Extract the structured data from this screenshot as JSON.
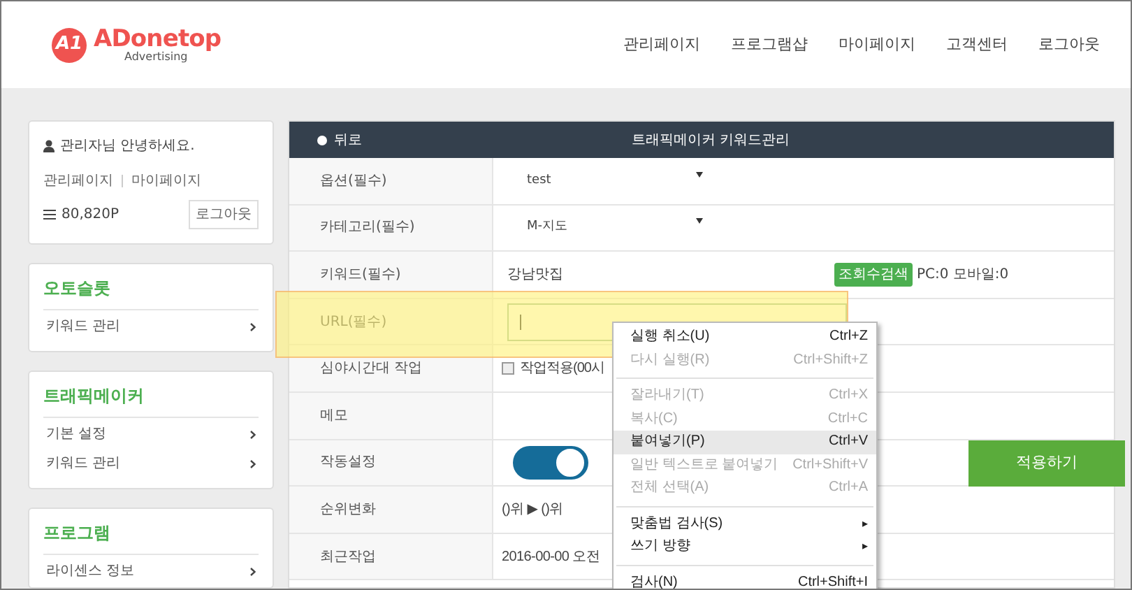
{
  "logo": {
    "mark": "A1",
    "name": "ADonetop",
    "tagline": "Advertising"
  },
  "nav": [
    "관리페이지",
    "프로그램샵",
    "마이페이지",
    "고객센터",
    "로그아웃"
  ],
  "user_card": {
    "greeting": "관리자님 안녕하세요.",
    "links": [
      "관리페이지",
      "마이페이지"
    ],
    "points": "80,820P",
    "logout": "로그아웃"
  },
  "side_menus": [
    {
      "title": "오토슬롯",
      "items": [
        "키워드 관리"
      ]
    },
    {
      "title": "트래픽메이커",
      "items": [
        "기본 설정",
        "키워드 관리"
      ]
    },
    {
      "title": "프로그램",
      "items": [
        "라이센스 정보"
      ]
    }
  ],
  "panel": {
    "back": "뒤로",
    "title": "트래픽메이커 키워드관리"
  },
  "rows": [
    {
      "kind": "select",
      "label": "옵션(필수)",
      "value": "test"
    },
    {
      "kind": "select",
      "label": "카테고리(필수)",
      "value": "M-지도"
    },
    {
      "kind": "keyword",
      "label": "키워드(필수)",
      "value": "강남맛집",
      "button": "조회수검색",
      "result": "PC:0 모바일:0"
    },
    {
      "kind": "input",
      "label": "URL(필수)",
      "focused": true
    },
    {
      "kind": "checkbox",
      "label": "심야시간대 작업",
      "checked": false,
      "value": "작업적용(00시"
    },
    {
      "kind": "blank",
      "label": "메모"
    },
    {
      "kind": "toggle",
      "label": "작동설정",
      "on": true,
      "button": "적용하기"
    },
    {
      "kind": "text",
      "label": "순위변화",
      "value": "()위 ▶ ()위"
    },
    {
      "kind": "text",
      "label": "최근작업",
      "value": "2016-00-00 오전"
    }
  ],
  "context_menu": [
    {
      "kind": "item",
      "label": "실행 취소(U)",
      "shortcut": "Ctrl+Z",
      "disabled": false,
      "selected": false
    },
    {
      "kind": "item",
      "label": "다시 실행(R)",
      "shortcut": "Ctrl+Shift+Z",
      "disabled": true,
      "selected": false
    },
    {
      "kind": "separator"
    },
    {
      "kind": "item",
      "label": "잘라내기(T)",
      "shortcut": "Ctrl+X",
      "disabled": true,
      "selected": false
    },
    {
      "kind": "item",
      "label": "복사(C)",
      "shortcut": "Ctrl+C",
      "disabled": true,
      "selected": false
    },
    {
      "kind": "item",
      "label": "붙여넣기(P)",
      "shortcut": "Ctrl+V",
      "disabled": false,
      "selected": true
    },
    {
      "kind": "item",
      "label": "일반 텍스트로 붙여넣기",
      "shortcut": "Ctrl+Shift+V",
      "disabled": true,
      "selected": false
    },
    {
      "kind": "item",
      "label": "전체 선택(A)",
      "shortcut": "Ctrl+A",
      "disabled": true,
      "selected": false
    },
    {
      "kind": "separator"
    },
    {
      "kind": "submenu",
      "label": "맞춤법 검사(S)",
      "arrow": "▸",
      "disabled": false,
      "selected": false
    },
    {
      "kind": "submenu",
      "label": "쓰기 방향",
      "arrow": "▸",
      "disabled": false,
      "selected": false
    },
    {
      "kind": "separator"
    },
    {
      "kind": "item",
      "label": "검사(N)",
      "shortcut": "Ctrl+Shift+I",
      "disabled": false,
      "selected": false
    }
  ]
}
